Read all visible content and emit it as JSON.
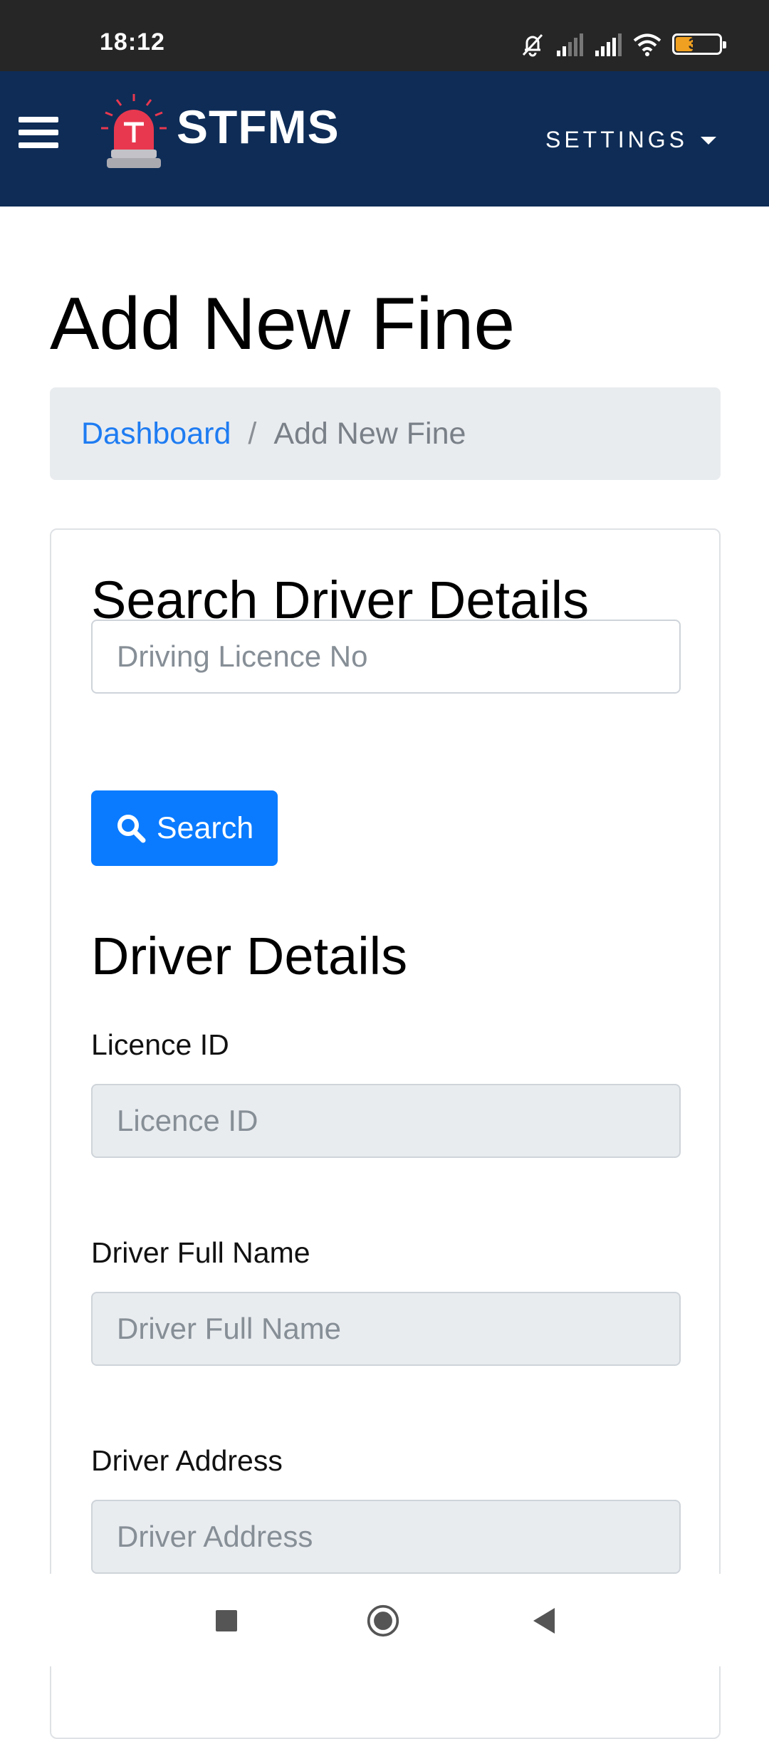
{
  "status_bar": {
    "time": "18:12",
    "battery_level": "37",
    "icons": [
      "bell-off-icon",
      "signal-icon",
      "signal-icon",
      "wifi-icon",
      "battery-icon"
    ]
  },
  "navbar": {
    "brand": "STFMS",
    "settings_label": "SETTINGS",
    "background": "#0e2c56"
  },
  "page": {
    "title": "Add New Fine",
    "breadcrumb": {
      "home": "Dashboard",
      "separator": "/",
      "current": "Add New Fine"
    }
  },
  "search_section": {
    "title": "Search Driver Details",
    "licence_placeholder": "Driving Licence No",
    "licence_value": "",
    "search_label": "Search"
  },
  "driver_details": {
    "title": "Driver Details",
    "fields": [
      {
        "label": "Licence ID",
        "placeholder": "Licence ID",
        "value": ""
      },
      {
        "label": "Driver Full Name",
        "placeholder": "Driver Full Name",
        "value": ""
      },
      {
        "label": "Driver Address",
        "placeholder": "Driver Address",
        "value": ""
      }
    ]
  },
  "colors": {
    "primary": "#0a7bff",
    "link": "#1e7cf2",
    "readonly_bg": "#e9ecef"
  }
}
